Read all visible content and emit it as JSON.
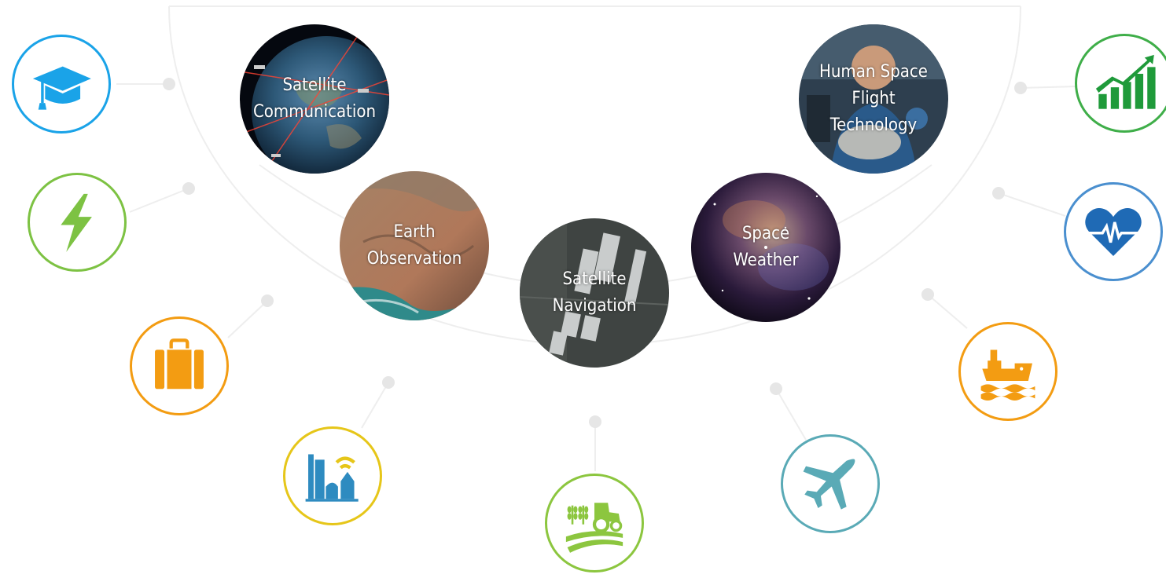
{
  "topics": [
    {
      "id": "satcom",
      "label_lines": [
        "Satellite",
        "Communication"
      ]
    },
    {
      "id": "eo",
      "label_lines": [
        "Earth",
        "Observation"
      ]
    },
    {
      "id": "satnav",
      "label_lines": [
        "Satellite",
        "Navigation"
      ]
    },
    {
      "id": "spaceweather",
      "label_lines": [
        "Space",
        "Weather"
      ]
    },
    {
      "id": "humanspace",
      "label_lines": [
        "Human Space",
        "Flight",
        "Technology"
      ]
    }
  ],
  "sectors": [
    {
      "icon": "graduation-cap-icon",
      "color": "#1aa3e8"
    },
    {
      "icon": "lightning-bolt-icon",
      "color": "#7dc243"
    },
    {
      "icon": "suitcase-icon",
      "color": "#f39c12"
    },
    {
      "icon": "smart-city-icon",
      "color": "#e6c619"
    },
    {
      "icon": "agriculture-tractor-icon",
      "color": "#8cc63f"
    },
    {
      "icon": "airplane-icon",
      "color": "#5aaab6"
    },
    {
      "icon": "ship-icon",
      "color": "#f39c12"
    },
    {
      "icon": "heart-pulse-icon",
      "color": "#4a8fcf"
    },
    {
      "icon": "growth-chart-icon",
      "color": "#3fae49"
    }
  ]
}
